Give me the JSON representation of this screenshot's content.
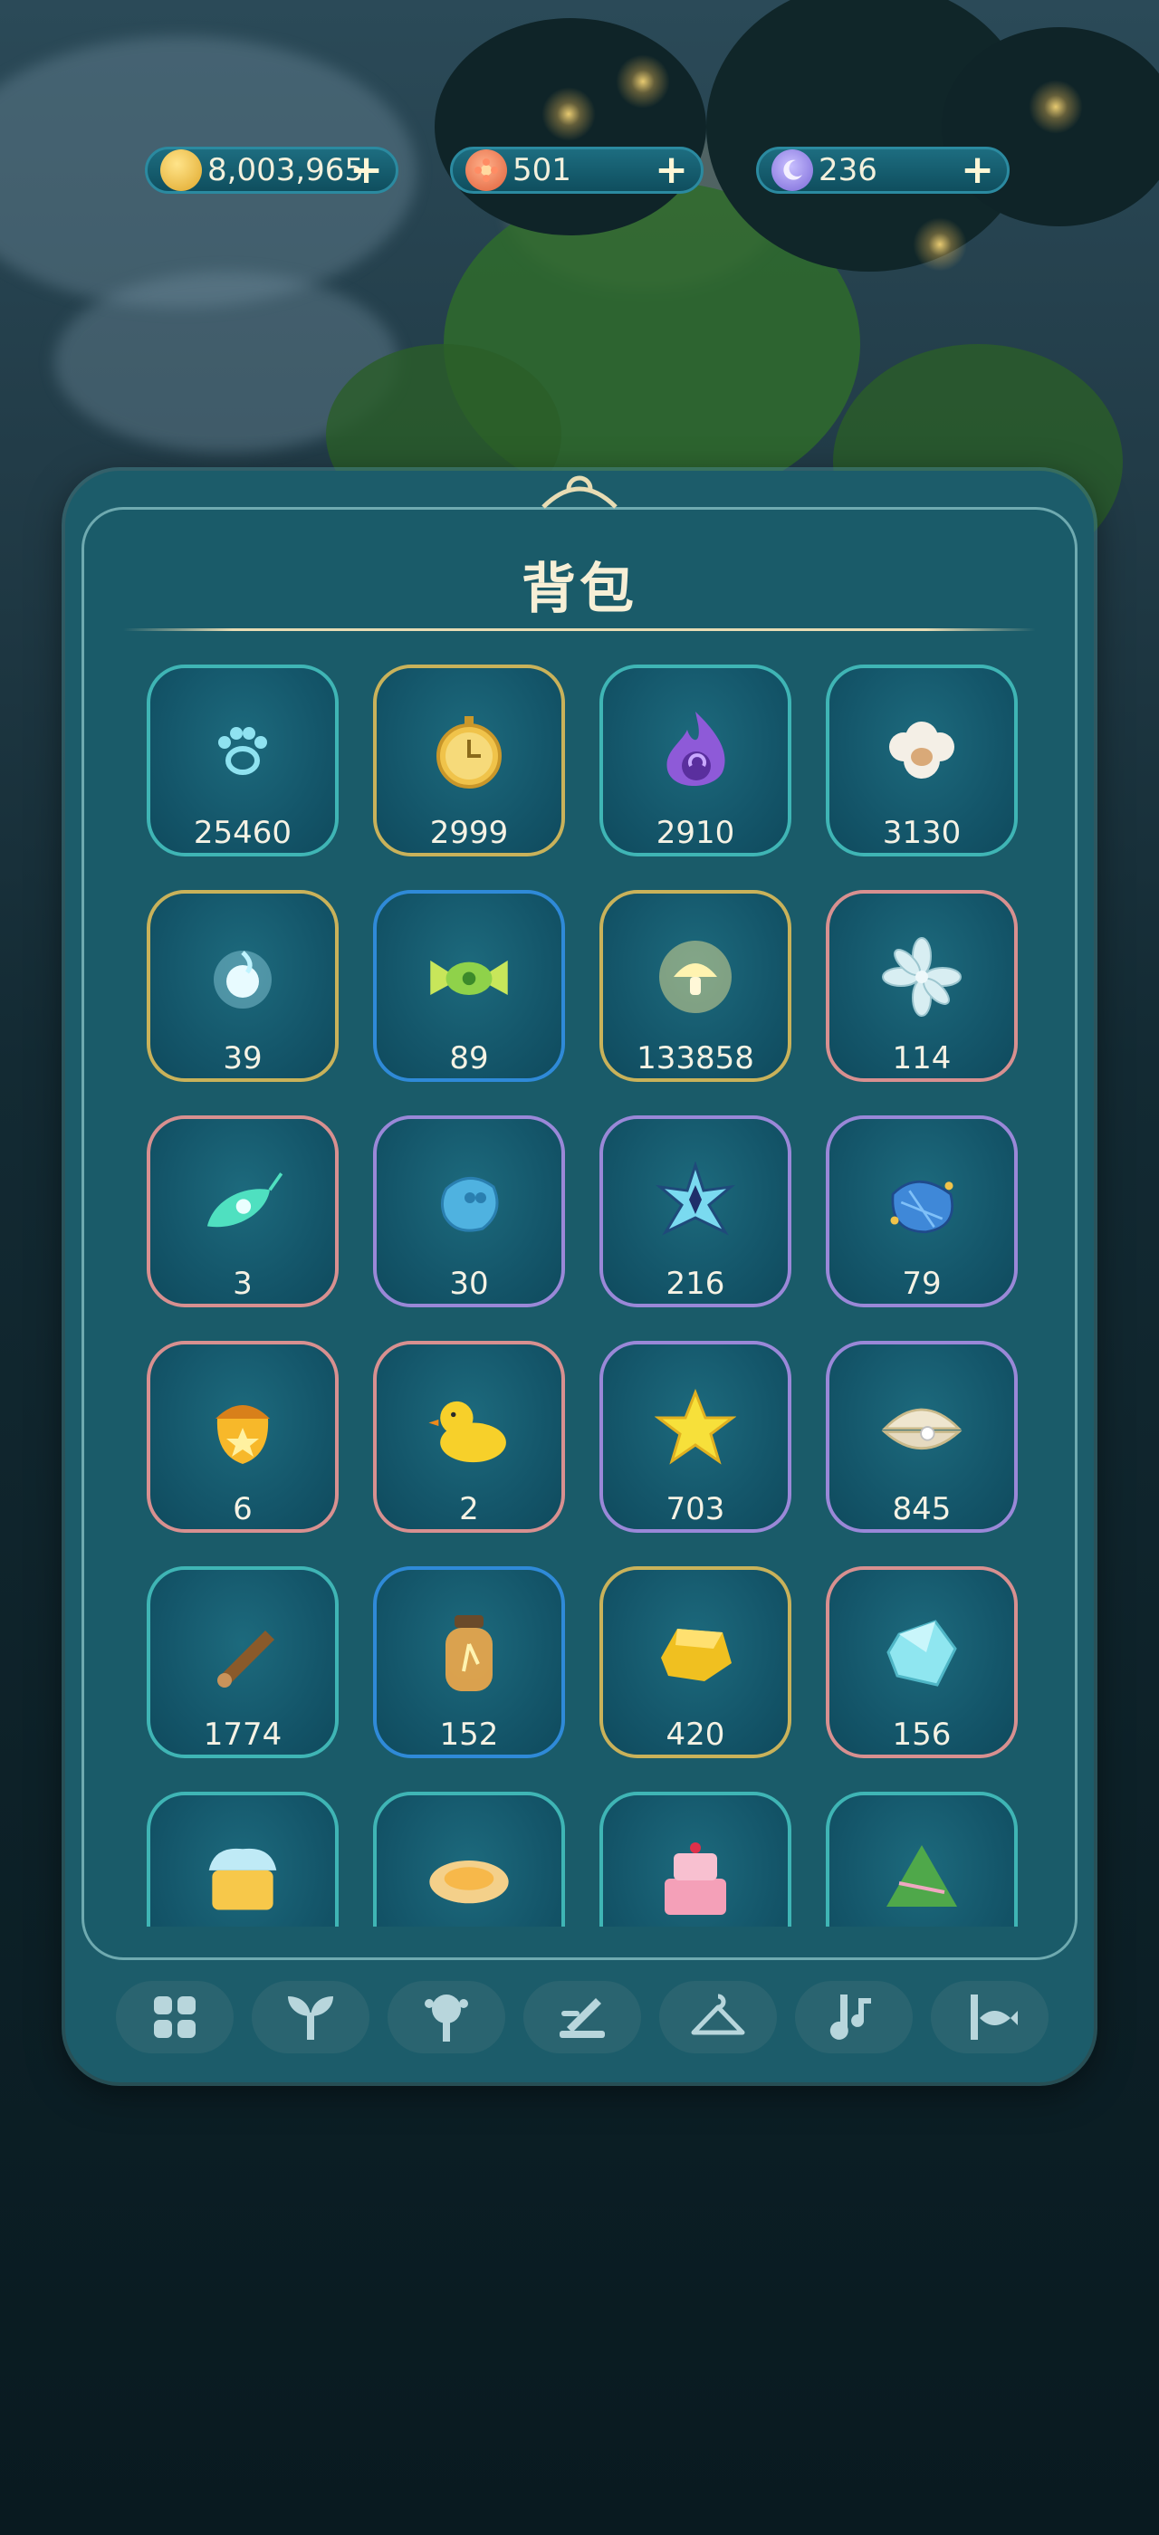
{
  "currencies": [
    {
      "name": "coin",
      "value": "8,003,965",
      "icon": "gold-coin-icon"
    },
    {
      "name": "flower-token",
      "value": "501",
      "icon": "flower-token-icon"
    },
    {
      "name": "moon-token",
      "value": "236",
      "icon": "moon-token-icon"
    }
  ],
  "panel": {
    "title": "背包"
  },
  "items": [
    {
      "icon": "paw-print-icon",
      "count": "25460"
    },
    {
      "icon": "pocket-watch-icon",
      "count": "2999"
    },
    {
      "icon": "purple-flame-icon",
      "count": "2910"
    },
    {
      "icon": "wool-sheep-icon",
      "count": "3130"
    },
    {
      "icon": "glowing-orb-icon",
      "count": "39"
    },
    {
      "icon": "green-candy-icon",
      "count": "89"
    },
    {
      "icon": "golden-mushroom-icon",
      "count": "133858"
    },
    {
      "icon": "white-flower-icon",
      "count": "114"
    },
    {
      "icon": "feather-icon",
      "count": "3"
    },
    {
      "icon": "water-drop-icon",
      "count": "30"
    },
    {
      "icon": "star-crystal-icon",
      "count": "216"
    },
    {
      "icon": "blue-bag-icon",
      "count": "79"
    },
    {
      "icon": "golden-acorn-icon",
      "count": "6"
    },
    {
      "icon": "rubber-duck-icon",
      "count": "2"
    },
    {
      "icon": "yellow-star-icon",
      "count": "703"
    },
    {
      "icon": "pearl-shell-icon",
      "count": "845"
    },
    {
      "icon": "wood-log-icon",
      "count": "1774"
    },
    {
      "icon": "jar-icon",
      "count": "152"
    },
    {
      "icon": "gold-nugget-icon",
      "count": "420"
    },
    {
      "icon": "diamond-icon",
      "count": "156"
    },
    {
      "icon": "cupcake-icon",
      "count": ""
    },
    {
      "icon": "egg-tart-icon",
      "count": ""
    },
    {
      "icon": "layer-cake-icon",
      "count": ""
    },
    {
      "icon": "rice-dumpling-icon",
      "count": ""
    }
  ],
  "tabs": [
    {
      "icon": "grid-icon"
    },
    {
      "icon": "sprout-icon"
    },
    {
      "icon": "lamp-icon"
    },
    {
      "icon": "tools-icon"
    },
    {
      "icon": "hanger-icon"
    },
    {
      "icon": "music-icon"
    },
    {
      "icon": "fish-icon"
    }
  ],
  "colors": {
    "accent": "#3fb5b5",
    "panel": "#1c5c6a",
    "text": "#f5f2e4"
  }
}
